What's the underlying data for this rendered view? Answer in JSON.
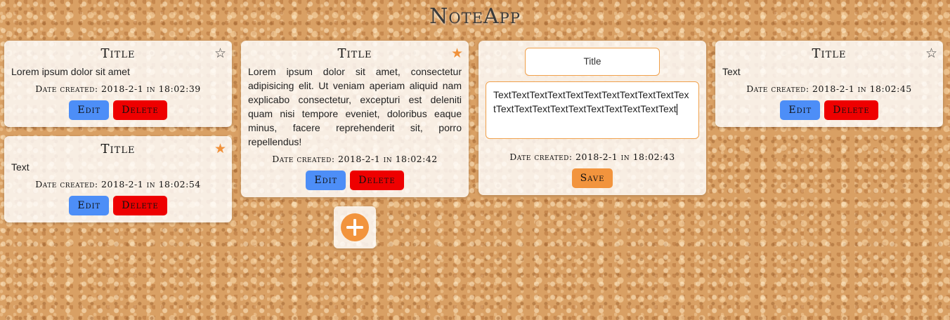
{
  "app": {
    "title": "NoteApp"
  },
  "colors": {
    "accent": "#f2943d",
    "edit": "#4d8ef7",
    "delete": "#ee0000"
  },
  "notes": [
    {
      "title": "Title",
      "text": "Lorem ipsum dolor sit amet",
      "starred": false,
      "date": "Date created: 2018-2-1 in 18:02:39",
      "edit_label": "Edit",
      "delete_label": "Delete",
      "star_icon": "star-outline-icon"
    },
    {
      "title": "Title",
      "text": "Text",
      "starred": true,
      "date": "Date created: 2018-2-1 in 18:02:54",
      "edit_label": "Edit",
      "delete_label": "Delete",
      "star_icon": "star-filled-icon"
    },
    {
      "title": "Title",
      "text": "Lorem ipsum dolor sit amet, consectetur adipisicing elit. Ut veniam aperiam aliquid nam explicabo consectetur, excepturi est deleniti quam nisi tempore eveniet, doloribus eaque minus, facere reprehenderit sit, porro repellendus!",
      "starred": true,
      "date": "Date created: 2018-2-1 in 18:02:42",
      "edit_label": "Edit",
      "delete_label": "Delete",
      "star_icon": "star-filled-icon"
    },
    {
      "title": "Title",
      "text": "Text",
      "starred": false,
      "date": "Date created: 2018-2-1 in 18:02:45",
      "edit_label": "Edit",
      "delete_label": "Delete",
      "star_icon": "star-outline-icon"
    }
  ],
  "editing": {
    "title_value": "Title",
    "body_value": "TextTextTextTextTextTextTextTextTextTextTextTextTextTextTextTextTextTextTextTextText",
    "date": "Date created: 2018-2-1 in 18:02:43",
    "save_label": "Save"
  },
  "add_button": {
    "icon": "plus-icon"
  }
}
